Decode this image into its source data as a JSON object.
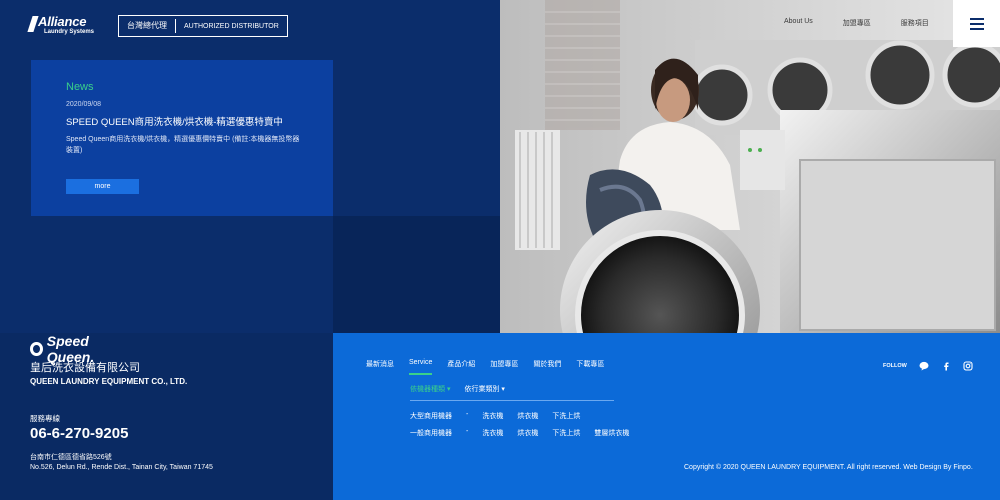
{
  "header": {
    "brand_name": "Alliance",
    "brand_sub": "Laundry Systems",
    "badge_cn": "台灣總代理",
    "badge_en": "AUTHORIZED DISTRIBUTOR",
    "nav": [
      "About Us",
      "加盟專區",
      "服務項目"
    ]
  },
  "news": {
    "tag": "News",
    "date": "2020/09/08",
    "headline": "SPEED QUEEN商用洗衣機/烘衣機-精選優惠特賣中",
    "body": "Speed Queen商用洗衣機/烘衣機，精選優惠價特賣中 (備註:本機器無投幣器裝置)",
    "more_label": "more"
  },
  "company": {
    "logo_text": "Speed Queen.",
    "cn_name": "皇后洗衣設備有限公司",
    "en_name": "QUEEN LAUNDRY EQUIPMENT CO., LTD.",
    "hotline_label": "服務專線",
    "hotline": "06-6-270-9205",
    "address_cn": "台南市仁德區德省路526號",
    "address_en": "No.526, Delun Rd., Rende Dist., Tainan City, Taiwan 71745"
  },
  "footer": {
    "nav": [
      "最新消息",
      "Service",
      "產品介紹",
      "加盟專區",
      "關於我們",
      "下載專區"
    ],
    "active_index": 1,
    "sub_tabs": [
      "依機器種類",
      "依行業類別"
    ],
    "product_rows": [
      [
        "大型商用機器",
        "-",
        "洗衣機",
        "烘衣機",
        "下洗上烘"
      ],
      [
        "一般商用機器",
        "-",
        "洗衣機",
        "烘衣機",
        "下洗上烘",
        "雙層烘衣機"
      ]
    ],
    "follow_label": "FOLLOW",
    "copyright": "Copyright © 2020 QUEEN LAUNDRY EQUIPMENT. All right reserved. Web Design By Finpo."
  },
  "colors": {
    "navy": "#0b2d6b",
    "card_blue": "#0c40a0",
    "footer_blue": "#0c6ad8",
    "accent_green": "#3ad08a"
  },
  "icons": [
    "menu-icon",
    "chat-icon",
    "facebook-icon",
    "instagram-icon",
    "caret-down-icon"
  ]
}
